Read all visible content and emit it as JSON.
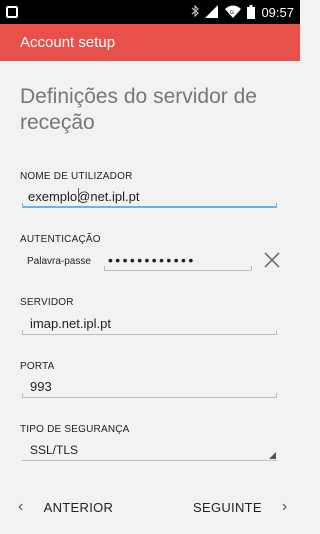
{
  "status_bar": {
    "time": "09:57",
    "icons": [
      "notification-icon",
      "bluetooth-icon",
      "signal-icon",
      "wifi-icon",
      "battery-icon"
    ]
  },
  "app_bar": {
    "title": "Account setup",
    "color": "#e8504a"
  },
  "page": {
    "heading": "Definições do servidor de receção"
  },
  "fields": {
    "username": {
      "label": "NOME DE UTILIZADOR",
      "value": "exemplo@net.ipl.pt"
    },
    "authentication": {
      "label": "AUTENTICAÇÃO",
      "type": "Palavra-passe",
      "value": "••••••••••••"
    },
    "server": {
      "label": "SERVIDOR",
      "value": "imap.net.ipl.pt"
    },
    "port": {
      "label": "PORTA",
      "value": "993"
    },
    "security": {
      "label": "TIPO DE SEGURANÇA",
      "value": "SSL/TLS"
    }
  },
  "nav": {
    "previous": "ANTERIOR",
    "next": "SEGUINTE"
  },
  "colors": {
    "accent_underline": "#68b7d9",
    "inactive_underline": "#bdbdbd"
  }
}
